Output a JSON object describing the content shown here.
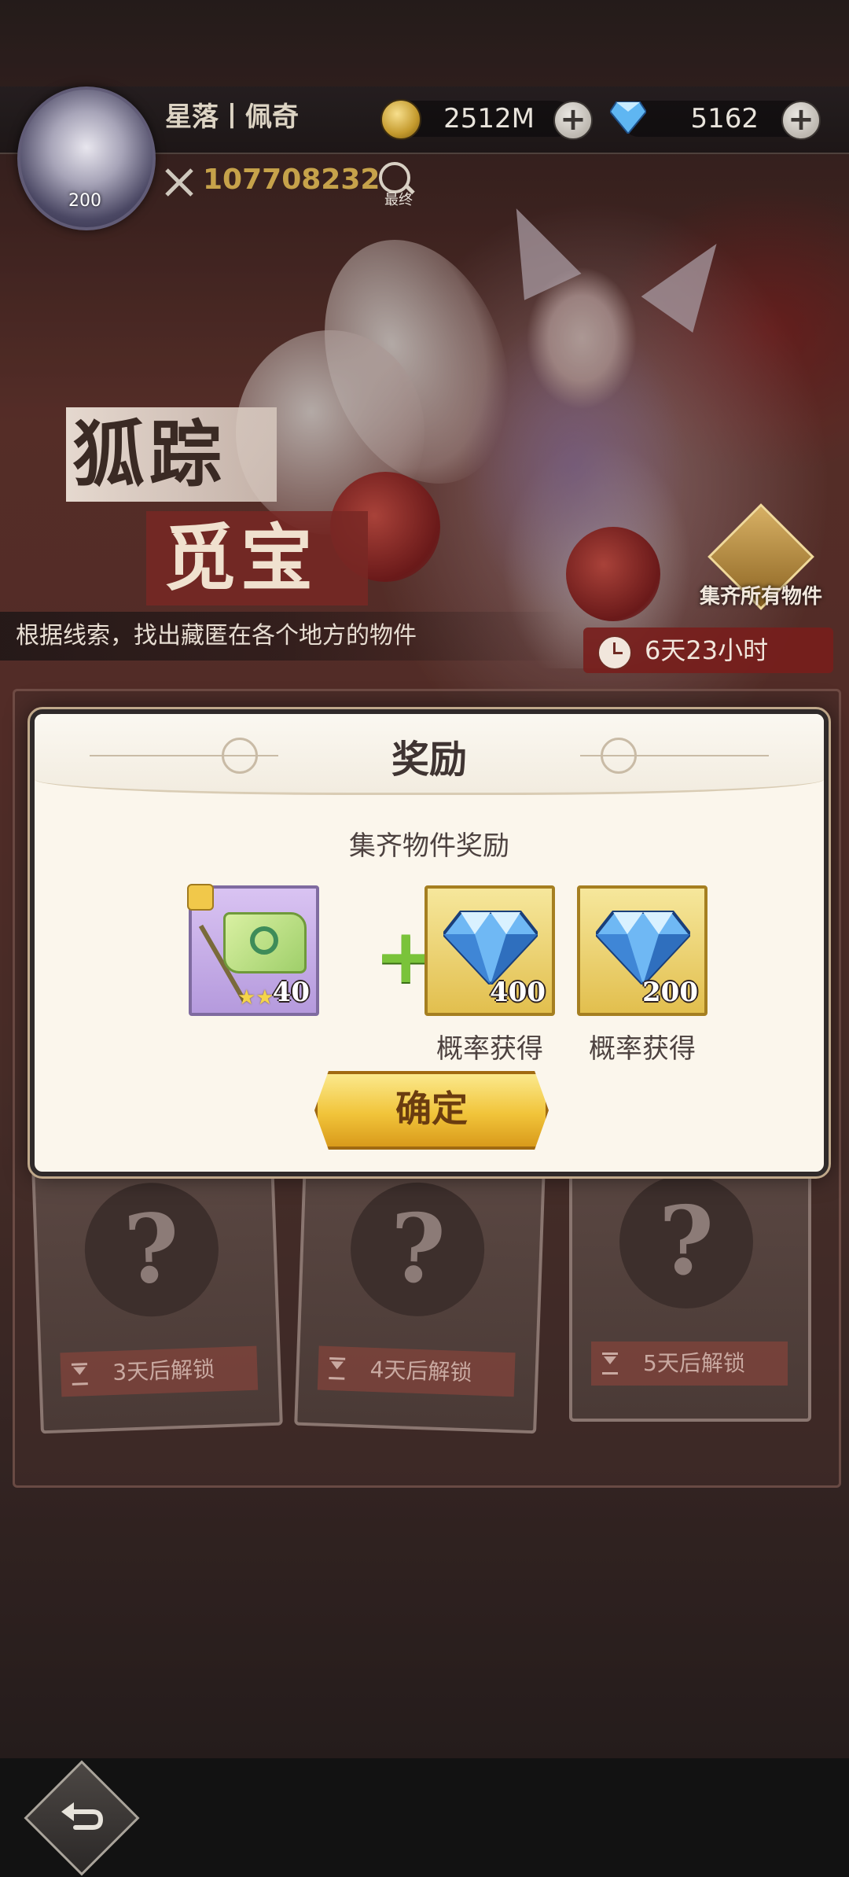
{
  "player": {
    "name": "星落丨佩奇",
    "level": "200",
    "combat_power": "107708232",
    "search_label": "最终"
  },
  "resources": {
    "gold": "2512M",
    "gems": "5162"
  },
  "event": {
    "title_line1": "狐踪",
    "title_line2": "觅宝",
    "description": "根据线索，找出藏匿在各个地方的物件",
    "collect_all_label": "集齐所有物件",
    "countdown": "6天23小时"
  },
  "locked_cards": [
    {
      "unlock_label": "3天后解锁"
    },
    {
      "unlock_label": "4天后解锁"
    },
    {
      "unlock_label": "5天后解锁"
    }
  ],
  "reward_modal": {
    "title": "奖励",
    "subtitle": "集齐物件奖励",
    "items": [
      {
        "icon": "flag-icon",
        "count": "40"
      },
      {
        "icon": "diamond-icon",
        "count": "400",
        "note": "概率获得"
      },
      {
        "icon": "diamond-icon",
        "count": "200",
        "note": "概率获得"
      }
    ],
    "confirm_label": "确定"
  },
  "colors": {
    "modal_bg": "#fbf6ec",
    "button_gold": "#f1c43a",
    "plus_green": "#7ac33a",
    "combat_gold": "#c6a24a"
  }
}
